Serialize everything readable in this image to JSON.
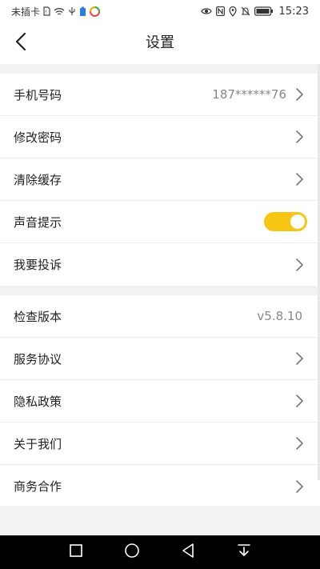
{
  "status_bar": {
    "carrier": "未插卡",
    "time": "15:23",
    "icons_left": [
      "sim-icon",
      "wifi-icon",
      "usb-icon",
      "battery-saver-icon",
      "app-icon"
    ],
    "icons_right": [
      "eye-icon",
      "nfc-icon",
      "location-icon",
      "mute-icon",
      "battery-icon"
    ]
  },
  "header": {
    "title": "设置"
  },
  "groups": [
    {
      "items": [
        {
          "label": "手机号码",
          "value": "187******76",
          "chevron": true
        },
        {
          "label": "修改密码",
          "value": "",
          "chevron": true
        },
        {
          "label": "清除缓存",
          "value": "",
          "chevron": true
        },
        {
          "label": "声音提示",
          "toggle": true,
          "toggle_on": true
        },
        {
          "label": "我要投诉",
          "value": "",
          "chevron": true
        }
      ]
    },
    {
      "items": [
        {
          "label": "检查版本",
          "value": "v5.8.10",
          "chevron": false
        },
        {
          "label": "服务协议",
          "value": "",
          "chevron": true
        },
        {
          "label": "隐私政策",
          "value": "",
          "chevron": true
        },
        {
          "label": "关于我们",
          "value": "",
          "chevron": true
        },
        {
          "label": "商务合作",
          "value": "",
          "chevron": true
        }
      ]
    }
  ],
  "colors": {
    "accent": "#f7c615",
    "background": "#f5f5f5",
    "row_bg": "#ffffff",
    "text": "#222222",
    "secondary_text": "#888888"
  }
}
